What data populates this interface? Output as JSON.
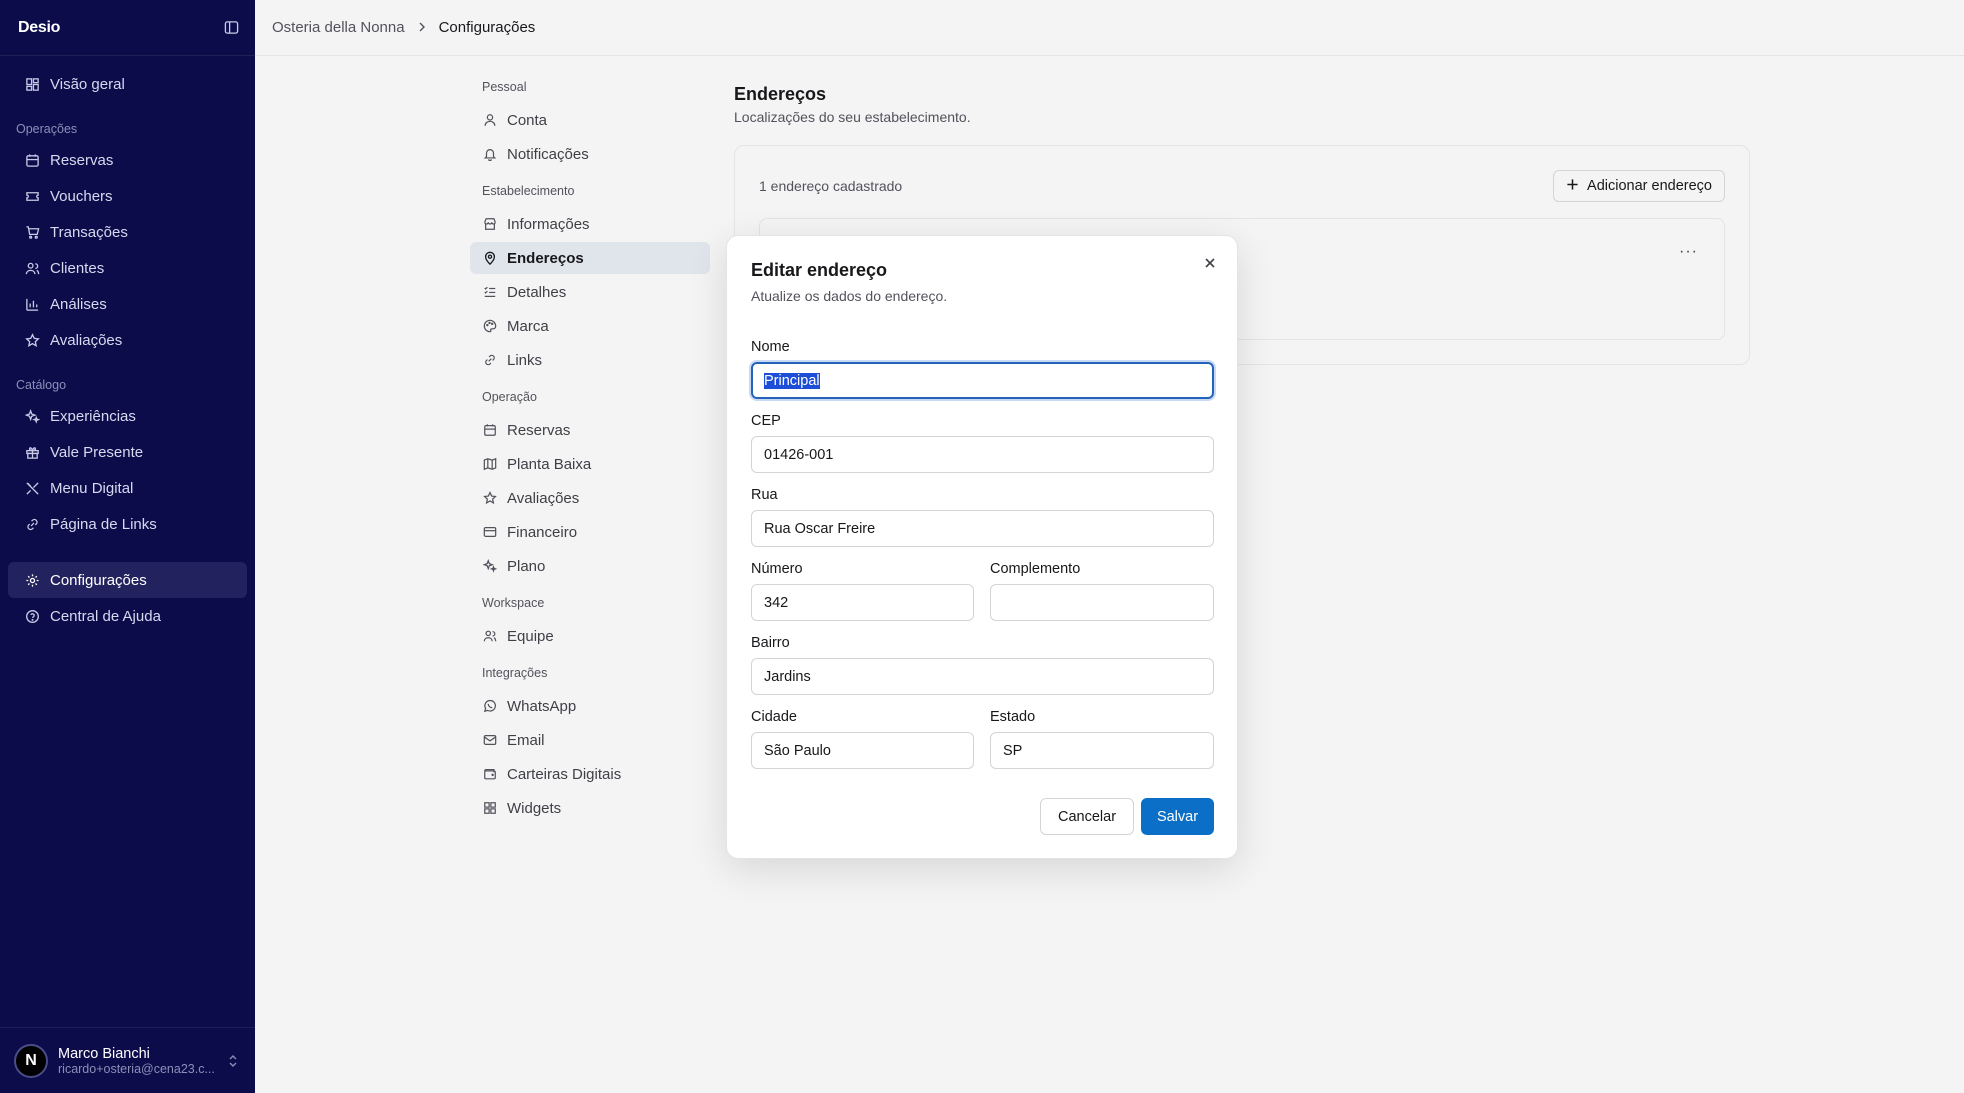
{
  "app": {
    "logo": "Desio"
  },
  "sidebar": {
    "top_items": [
      {
        "label": "Visão geral",
        "icon": "dashboard-icon"
      }
    ],
    "sections": [
      {
        "title": "Operações",
        "items": [
          {
            "label": "Reservas",
            "icon": "calendar-icon"
          },
          {
            "label": "Vouchers",
            "icon": "ticket-icon"
          },
          {
            "label": "Transações",
            "icon": "cart-icon"
          },
          {
            "label": "Clientes",
            "icon": "users-icon"
          },
          {
            "label": "Análises",
            "icon": "bar-chart-icon"
          },
          {
            "label": "Avaliações",
            "icon": "star-icon"
          }
        ]
      },
      {
        "title": "Catálogo",
        "items": [
          {
            "label": "Experiências",
            "icon": "sparkles-icon"
          },
          {
            "label": "Vale Presente",
            "icon": "gift-icon"
          },
          {
            "label": "Menu Digital",
            "icon": "utensils-icon"
          },
          {
            "label": "Página de Links",
            "icon": "link-icon"
          }
        ]
      }
    ],
    "bottom_items": [
      {
        "label": "Configurações",
        "icon": "gear-icon",
        "active": true
      },
      {
        "label": "Central de Ajuda",
        "icon": "help-icon"
      }
    ],
    "user": {
      "avatar_letter": "N",
      "name": "Marco Bianchi",
      "email": "ricardo+osteria@cena23.c..."
    }
  },
  "header": {
    "breadcrumb": [
      "Osteria della Nonna",
      "Configurações"
    ]
  },
  "settings_nav": [
    {
      "title": "Pessoal",
      "items": [
        {
          "label": "Conta",
          "icon": "user-icon"
        },
        {
          "label": "Notificações",
          "icon": "bell-icon"
        }
      ]
    },
    {
      "title": "Estabelecimento",
      "items": [
        {
          "label": "Informações",
          "icon": "store-icon"
        },
        {
          "label": "Endereços",
          "icon": "map-pin-icon",
          "active": true
        },
        {
          "label": "Detalhes",
          "icon": "list-icon"
        },
        {
          "label": "Marca",
          "icon": "palette-icon"
        },
        {
          "label": "Links",
          "icon": "link-icon"
        }
      ]
    },
    {
      "title": "Operação",
      "items": [
        {
          "label": "Reservas",
          "icon": "calendar-icon"
        },
        {
          "label": "Planta Baixa",
          "icon": "map-icon"
        },
        {
          "label": "Avaliações",
          "icon": "star-icon"
        },
        {
          "label": "Financeiro",
          "icon": "credit-card-icon"
        },
        {
          "label": "Plano",
          "icon": "sparkles-icon"
        }
      ]
    },
    {
      "title": "Workspace",
      "items": [
        {
          "label": "Equipe",
          "icon": "users-icon"
        }
      ]
    },
    {
      "title": "Integrações",
      "items": [
        {
          "label": "WhatsApp",
          "icon": "whatsapp-icon"
        },
        {
          "label": "Email",
          "icon": "mail-icon"
        },
        {
          "label": "Carteiras Digitais",
          "icon": "wallet-icon"
        },
        {
          "label": "Widgets",
          "icon": "grid-icon"
        }
      ]
    }
  ],
  "main": {
    "title": "Endereços",
    "subtitle": "Localizações do seu estabelecimento.",
    "count_text": "1 endereço cadastrado",
    "add_button": "Adicionar endereço",
    "more_label": "···"
  },
  "modal": {
    "title": "Editar endereço",
    "subtitle": "Atualize os dados do endereço.",
    "fields": {
      "nome": {
        "label": "Nome",
        "value": "Principal"
      },
      "cep": {
        "label": "CEP",
        "value": "01426-001"
      },
      "rua": {
        "label": "Rua",
        "value": "Rua Oscar Freire"
      },
      "numero": {
        "label": "Número",
        "value": "342"
      },
      "complemento": {
        "label": "Complemento",
        "value": ""
      },
      "bairro": {
        "label": "Bairro",
        "value": "Jardins"
      },
      "cidade": {
        "label": "Cidade",
        "value": "São Paulo"
      },
      "estado": {
        "label": "Estado",
        "value": "SP"
      }
    },
    "cancel_label": "Cancelar",
    "save_label": "Salvar"
  },
  "colors": {
    "sidebar_bg": "#0c0c4a",
    "primary": "#0b6fc7",
    "focus_ring": "#2563b9"
  }
}
